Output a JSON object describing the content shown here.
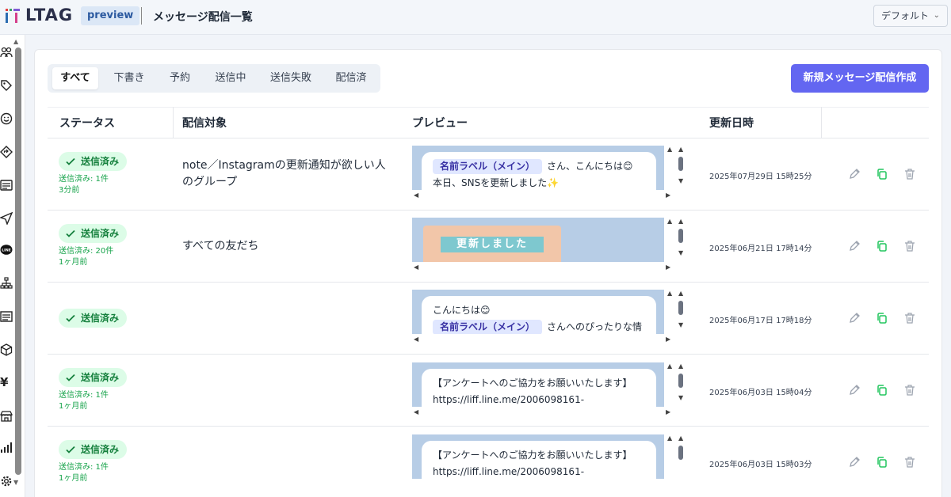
{
  "header": {
    "logo_text": "LTAG",
    "env_badge": "preview",
    "page_title": "メッセージ配信一覧",
    "account_select": "デフォルト"
  },
  "sidebar": {
    "icons": [
      "users-icon",
      "tag-icon",
      "smile-icon",
      "diamond-arrow-icon",
      "form-icon",
      "send-icon",
      "line-icon",
      "sitemap-icon",
      "list-icon",
      "box-icon",
      "yen-icon",
      "store-icon",
      "bar-chart-icon",
      "gear-icon"
    ]
  },
  "tabs": [
    "すべて",
    "下書き",
    "予約",
    "送信中",
    "送信失敗",
    "配信済"
  ],
  "active_tab": 0,
  "new_button": "新規メッセージ配信作成",
  "columns": {
    "status": "ステータス",
    "target": "配信対象",
    "preview": "プレビュー",
    "updated": "更新日時"
  },
  "rows": [
    {
      "status": "送信済み",
      "sent_count": "送信済み: 1件",
      "ago": "3分前",
      "target": "note／Instagramの更新通知が欲しい人のグループ",
      "preview_label": "名前ラベル（メイン）",
      "preview_line1_rest": "さん、こんにちは😊",
      "preview_line2": "本日、SNSを更新しました✨",
      "updated": "2025年07月29日 15時25分"
    },
    {
      "status": "送信済み",
      "sent_count": "送信済み: 20件",
      "ago": "1ヶ月前",
      "target": "すべての友だち",
      "preview_image_text": "更新しました",
      "updated": "2025年06月21日 17時14分"
    },
    {
      "status": "送信済み",
      "preview_line1": "こんにちは😊",
      "preview_label": "名前ラベル（メイン）",
      "preview_line2_rest": "さんへのぴったりな情",
      "updated": "2025年06月17日 17時18分"
    },
    {
      "status": "送信済み",
      "sent_count": "送信済み: 1件",
      "ago": "1ヶ月前",
      "preview_line1": "【アンケートへのご協力をお願いいたします】",
      "preview_line2": "https://liff.line.me/2006098161-",
      "updated": "2025年06月03日 15時04分"
    },
    {
      "status": "送信済み",
      "sent_count": "送信済み: 1件",
      "ago": "1ヶ月前",
      "preview_line1": "【アンケートへのご協力をお願いいたします】",
      "preview_line2": "https://liff.line.me/2006098161-",
      "updated": "2025年06月03日 15時03分"
    }
  ]
}
